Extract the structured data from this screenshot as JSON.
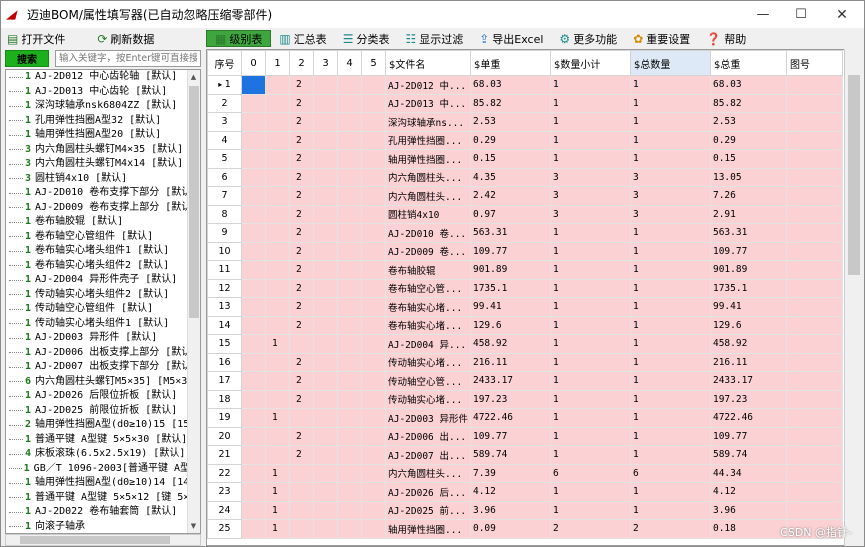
{
  "window": {
    "title": "迈迪BOM/属性填写器(已自动忽略压缩零部件)",
    "icon": "app-logo-icon",
    "min": "—",
    "max": "☐",
    "close": "✕"
  },
  "left_toolbar": {
    "open_file": "打开文件",
    "refresh": "刷新数据"
  },
  "search": {
    "button": "搜索",
    "placeholder": "输入关键字，按Enter键可直接搜索"
  },
  "toolbar": {
    "items": [
      {
        "label": "级别表",
        "icon": "level-table-icon",
        "active": true
      },
      {
        "label": "汇总表",
        "icon": "summary-table-icon"
      },
      {
        "label": "分类表",
        "icon": "category-table-icon"
      },
      {
        "label": "显示过滤",
        "icon": "filter-icon"
      },
      {
        "label": "导出Excel",
        "icon": "export-excel-icon"
      },
      {
        "label": "更多功能",
        "icon": "more-functions-icon"
      },
      {
        "label": "重要设置",
        "icon": "settings-icon"
      },
      {
        "label": "帮助",
        "icon": "help-icon"
      }
    ]
  },
  "tree": [
    {
      "n": "1",
      "label": "AJ-2D012 中心齿轮轴 [默认]"
    },
    {
      "n": "1",
      "label": "AJ-2D013 中心齿轮 [默认]"
    },
    {
      "n": "1",
      "label": "深沟球轴承nsk6804ZZ [默认]"
    },
    {
      "n": "1",
      "label": "孔用弹性挡圈A型32 [默认]"
    },
    {
      "n": "1",
      "label": "轴用弹性挡圈A型20 [默认]"
    },
    {
      "n": "3",
      "label": "内六角圆柱头螺钉M4×35 [默认]"
    },
    {
      "n": "3",
      "label": "内六角圆柱头螺钉M4x14 [默认]"
    },
    {
      "n": "3",
      "label": "圆柱销4x10 [默认]"
    },
    {
      "n": "1",
      "label": "AJ-2D010 卷布支撑下部分 [默认]"
    },
    {
      "n": "1",
      "label": "AJ-2D009 卷布支撑上部分 [默认]"
    },
    {
      "n": "1",
      "label": "卷布轴胶辊 [默认]"
    },
    {
      "n": "1",
      "label": "卷布轴空心管组件 [默认]"
    },
    {
      "n": "1",
      "label": "卷布轴实心堵头组件1 [默认]"
    },
    {
      "n": "1",
      "label": "卷布轴实心堵头组件2 [默认]"
    },
    {
      "n": "1",
      "label": "AJ-2D004 异形件壳子 [默认]"
    },
    {
      "n": "1",
      "label": "传动轴实心堵头组件2 [默认]"
    },
    {
      "n": "1",
      "label": "传动轴空心管组件 [默认]"
    },
    {
      "n": "1",
      "label": "传动轴实心堵头组件1 [默认]"
    },
    {
      "n": "1",
      "label": "AJ-2D003 异形件 [默认]"
    },
    {
      "n": "1",
      "label": "AJ-2D006 出板支撑上部分 [默认]"
    },
    {
      "n": "1",
      "label": "AJ-2D007 出板支撑下部分 [默认]"
    },
    {
      "n": "6",
      "label": "内六角圆柱头螺钉M5×35] [M5×35"
    },
    {
      "n": "1",
      "label": "AJ-2D026 后限位折板 [默认]"
    },
    {
      "n": "1",
      "label": "AJ-2D025 前限位折板 [默认]"
    },
    {
      "n": "2",
      "label": "轴用弹性挡圈A型(d0≥10)15 [15]"
    },
    {
      "n": "1",
      "label": "普通平键 A型键 5×5×30 [默认]"
    },
    {
      "n": "4",
      "label": "床板滚珠(6.5x2.5x19) [默认]"
    },
    {
      "n": "1",
      "label": "GB／T 1096-2003[普通平键 A型键"
    },
    {
      "n": "1",
      "label": "轴用弹性挡圈A型(d0≥10)14 [14]"
    },
    {
      "n": "1",
      "label": "普通平键 A型键 5×5×12 [键 5×"
    },
    {
      "n": "1",
      "label": "AJ-2D022 卷布轴套筒 [默认]"
    },
    {
      "n": "1",
      "label": "向滚子轴承"
    }
  ],
  "grid": {
    "headers": [
      "序号",
      "0",
      "1",
      "2",
      "3",
      "4",
      "5",
      "$文件名",
      "$单重",
      "$数量小计",
      "$总数量",
      "$总重",
      "图号"
    ],
    "rows": [
      {
        "no": "1",
        "lvl": [
          " ",
          "",
          "2",
          "",
          "",
          ""
        ],
        "name": "AJ-2D012 中...",
        "w": "68.03",
        "q": "1",
        "tq": "1",
        "tw": "68.03"
      },
      {
        "no": "2",
        "lvl": [
          "",
          "",
          "2",
          "",
          "",
          ""
        ],
        "name": "AJ-2D013 中...",
        "w": "85.82",
        "q": "1",
        "tq": "1",
        "tw": "85.82"
      },
      {
        "no": "3",
        "lvl": [
          "",
          "",
          "2",
          "",
          "",
          ""
        ],
        "name": "深沟球轴承ns...",
        "w": "2.53",
        "q": "1",
        "tq": "1",
        "tw": "2.53"
      },
      {
        "no": "4",
        "lvl": [
          "",
          "",
          "2",
          "",
          "",
          ""
        ],
        "name": "孔用弹性挡圈...",
        "w": "0.29",
        "q": "1",
        "tq": "1",
        "tw": "0.29"
      },
      {
        "no": "5",
        "lvl": [
          "",
          "",
          "2",
          "",
          "",
          ""
        ],
        "name": "轴用弹性挡圈...",
        "w": "0.15",
        "q": "1",
        "tq": "1",
        "tw": "0.15"
      },
      {
        "no": "6",
        "lvl": [
          "",
          "",
          "2",
          "",
          "",
          ""
        ],
        "name": "内六角圆柱头...",
        "w": "4.35",
        "q": "3",
        "tq": "3",
        "tw": "13.05"
      },
      {
        "no": "7",
        "lvl": [
          "",
          "",
          "2",
          "",
          "",
          ""
        ],
        "name": "内六角圆柱头...",
        "w": "2.42",
        "q": "3",
        "tq": "3",
        "tw": "7.26"
      },
      {
        "no": "8",
        "lvl": [
          "",
          "",
          "2",
          "",
          "",
          ""
        ],
        "name": "圆柱销4x10",
        "w": "0.97",
        "q": "3",
        "tq": "3",
        "tw": "2.91"
      },
      {
        "no": "9",
        "lvl": [
          "",
          "",
          "2",
          "",
          "",
          ""
        ],
        "name": "AJ-2D010 卷...",
        "w": "563.31",
        "q": "1",
        "tq": "1",
        "tw": "563.31"
      },
      {
        "no": "10",
        "lvl": [
          "",
          "",
          "2",
          "",
          "",
          ""
        ],
        "name": "AJ-2D009 卷...",
        "w": "109.77",
        "q": "1",
        "tq": "1",
        "tw": "109.77"
      },
      {
        "no": "11",
        "lvl": [
          "",
          "",
          "2",
          "",
          "",
          ""
        ],
        "name": "卷布轴胶辊",
        "w": "901.89",
        "q": "1",
        "tq": "1",
        "tw": "901.89"
      },
      {
        "no": "12",
        "lvl": [
          "",
          "",
          "2",
          "",
          "",
          ""
        ],
        "name": "卷布轴空心管...",
        "w": "1735.1",
        "q": "1",
        "tq": "1",
        "tw": "1735.1"
      },
      {
        "no": "13",
        "lvl": [
          "",
          "",
          "2",
          "",
          "",
          ""
        ],
        "name": "卷布轴实心堵...",
        "w": "99.41",
        "q": "1",
        "tq": "1",
        "tw": "99.41"
      },
      {
        "no": "14",
        "lvl": [
          "",
          "",
          "2",
          "",
          "",
          ""
        ],
        "name": "卷布轴实心堵...",
        "w": "129.6",
        "q": "1",
        "tq": "1",
        "tw": "129.6"
      },
      {
        "no": "15",
        "lvl": [
          "",
          "1",
          "",
          "",
          "",
          ""
        ],
        "name": "AJ-2D004 异...",
        "w": "458.92",
        "q": "1",
        "tq": "1",
        "tw": "458.92"
      },
      {
        "no": "16",
        "lvl": [
          "",
          "",
          "2",
          "",
          "",
          ""
        ],
        "name": "传动轴实心堵...",
        "w": "216.11",
        "q": "1",
        "tq": "1",
        "tw": "216.11"
      },
      {
        "no": "17",
        "lvl": [
          "",
          "",
          "2",
          "",
          "",
          ""
        ],
        "name": "传动轴空心管...",
        "w": "2433.17",
        "q": "1",
        "tq": "1",
        "tw": "2433.17"
      },
      {
        "no": "18",
        "lvl": [
          "",
          "",
          "2",
          "",
          "",
          ""
        ],
        "name": "传动轴实心堵...",
        "w": "197.23",
        "q": "1",
        "tq": "1",
        "tw": "197.23"
      },
      {
        "no": "19",
        "lvl": [
          "",
          "1",
          "",
          "",
          "",
          ""
        ],
        "name": "AJ-2D003 异形件",
        "w": "4722.46",
        "q": "1",
        "tq": "1",
        "tw": "4722.46"
      },
      {
        "no": "20",
        "lvl": [
          "",
          "",
          "2",
          "",
          "",
          ""
        ],
        "name": "AJ-2D006 出...",
        "w": "109.77",
        "q": "1",
        "tq": "1",
        "tw": "109.77"
      },
      {
        "no": "21",
        "lvl": [
          "",
          "",
          "2",
          "",
          "",
          ""
        ],
        "name": "AJ-2D007 出...",
        "w": "589.74",
        "q": "1",
        "tq": "1",
        "tw": "589.74"
      },
      {
        "no": "22",
        "lvl": [
          "",
          "1",
          "",
          "",
          "",
          ""
        ],
        "name": "内六角圆柱头...",
        "w": "7.39",
        "q": "6",
        "tq": "6",
        "tw": "44.34"
      },
      {
        "no": "23",
        "lvl": [
          "",
          "1",
          "",
          "",
          "",
          ""
        ],
        "name": "AJ-2D026 后...",
        "w": "4.12",
        "q": "1",
        "tq": "1",
        "tw": "4.12"
      },
      {
        "no": "24",
        "lvl": [
          "",
          "1",
          "",
          "",
          "",
          ""
        ],
        "name": "AJ-2D025 前...",
        "w": "3.96",
        "q": "1",
        "tq": "1",
        "tw": "3.96"
      },
      {
        "no": "25",
        "lvl": [
          "",
          "1",
          "",
          "",
          "",
          ""
        ],
        "name": "轴用弹性挡圈...",
        "w": "0.09",
        "q": "2",
        "tq": "2",
        "tw": "0.18"
      }
    ]
  },
  "watermark": "CSDN @指针-",
  "colors": {
    "row_bg": "#fbd1d3",
    "selected_cell": "#1e73e0",
    "active_tab": "#3fa63f",
    "search_button": "#1db01d"
  }
}
